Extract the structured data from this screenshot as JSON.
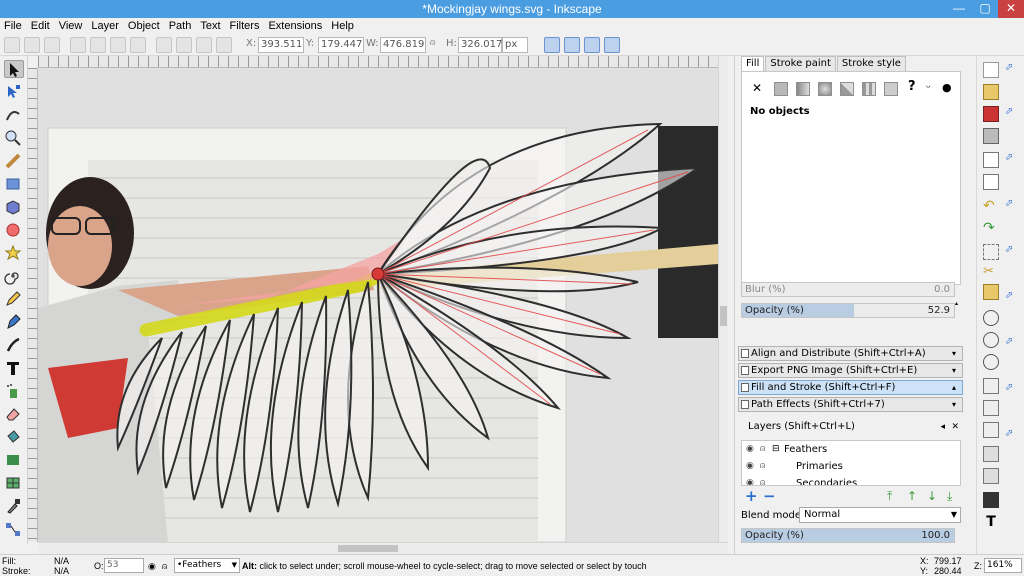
{
  "window": {
    "title": "*Mockingjay wings.svg - Inkscape",
    "minimize": "—",
    "maximize": "▢",
    "close": "✕"
  },
  "menu": [
    "File",
    "Edit",
    "View",
    "Layer",
    "Object",
    "Path",
    "Text",
    "Filters",
    "Extensions",
    "Help"
  ],
  "controls": {
    "x_label": "X:",
    "x_value": "393.511",
    "y_label": "Y:",
    "y_value": "179.447",
    "w_label": "W:",
    "w_value": "476.819",
    "h_label": "H:",
    "h_value": "326.017",
    "unit": "px"
  },
  "tools": [
    "selector-tool",
    "node-tool",
    "tweak-tool",
    "zoom-tool",
    "measure-tool",
    "rectangle-tool",
    "3d-box-tool",
    "ellipse-tool",
    "star-tool",
    "spiral-tool",
    "pencil-tool",
    "pen-tool",
    "calligraphy-tool",
    "text-tool",
    "spray-tool",
    "eraser-tool",
    "paint-bucket-tool",
    "gradient-tool",
    "mesh-tool",
    "dropper-tool",
    "connector-tool"
  ],
  "fill_stroke": {
    "tabs": [
      "Fill",
      "Stroke paint",
      "Stroke style"
    ],
    "paint_x": "✕",
    "paint_unknown": "?",
    "no_objects": "No objects",
    "blur_label": "Blur (%)",
    "blur_value": "0.0",
    "opacity_label": "Opacity (%)",
    "opacity_value": "52.9",
    "opacity_fraction": 0.529
  },
  "docks": [
    {
      "label": "Align and Distribute (Shift+Ctrl+A)",
      "open": false
    },
    {
      "label": "Export PNG Image (Shift+Ctrl+E)",
      "open": false
    },
    {
      "label": "Fill and Stroke (Shift+Ctrl+F)",
      "open": true
    },
    {
      "label": "Path Effects  (Shift+Ctrl+7)",
      "open": false
    }
  ],
  "layers": {
    "title": "Layers (Shift+Ctrl+L)",
    "items": [
      {
        "name": "Feathers",
        "expander": "⊟"
      },
      {
        "name": "Primaries",
        "expander": ""
      },
      {
        "name": "Secondaries",
        "expander": ""
      }
    ],
    "blend_label": "Blend mode:",
    "blend_value": "Normal",
    "opacity_label": "Opacity (%)",
    "opacity_value": "100.0"
  },
  "status": {
    "fill_label": "Fill:",
    "fill_value": "N/A",
    "stroke_label": "Stroke:",
    "stroke_value": "N/A",
    "o_label": "O:",
    "o_value": "53",
    "layer_value": "•Feathers",
    "message_bold": "Alt:",
    "message": " click to select under; scroll mouse-wheel to cycle-select; drag to move selected or select by touch",
    "x_label": "X:",
    "x_value": "799.17",
    "y_label": "Y:",
    "y_value": "280.44",
    "z_label": "Z:",
    "zoom_value": "161%"
  },
  "colors": {
    "accent": "#4a9de0",
    "selection": "#cde2f7",
    "wing_red": "#e8343a",
    "wing_yellow": "#d4d81a"
  }
}
